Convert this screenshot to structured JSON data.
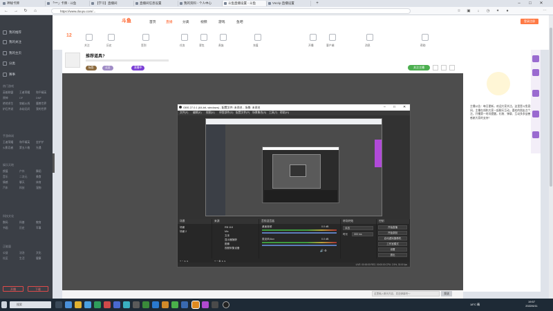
{
  "browser": {
    "tabs": [
      {
        "label": "神秘卡牌"
      },
      {
        "label": "「***」卡牌 - 斗鱼"
      },
      {
        "label": "【学习】直播间"
      },
      {
        "label": "直播间信息设置"
      },
      {
        "label": "我的资料 - 个人中心"
      },
      {
        "label": "斗鱼直播设置 - 斗鱼"
      },
      {
        "label": "Vscrip 直播设置"
      }
    ],
    "url": "https://www.douyu.com/..."
  },
  "sidebar": {
    "main_items": [
      {
        "label": "我的推荐"
      },
      {
        "label": "我的关注"
      },
      {
        "label": "我的主页"
      },
      {
        "label": "分类"
      },
      {
        "label": "赛事"
      }
    ],
    "sections": [
      {
        "title": "热门游戏",
        "items": [
          "英雄联盟",
          "王者荣耀",
          "和平精英",
          "原神",
          "CF",
          "DNF",
          "绝地求生",
          "穿越火线",
          "魔兽世界",
          "炉石传说",
          "永劫无间",
          "我的世界"
        ]
      },
      {
        "title": "手游休闲",
        "items": [
          "王者荣耀",
          "和平精英",
          "金铲铲",
          "火影忍者",
          "第五人格",
          "光遇"
        ]
      },
      {
        "title": "娱乐天地",
        "items": [
          "颜值",
          "户外",
          "舞蹈",
          "音乐",
          "二次元",
          "美食",
          "情感",
          "聊天",
          "体育",
          "汽车",
          "科技",
          "宠物"
        ]
      },
      {
        "title": "科技文化",
        "items": [
          "数码",
          "科普",
          "教育",
          "书画",
          "历史",
          "军事"
        ]
      },
      {
        "title": "正能量",
        "items": [
          "公益",
          "法治",
          "文化",
          "社区",
          "生活",
          "健康"
        ]
      }
    ],
    "bottom_buttons": [
      "开播",
      "下载"
    ]
  },
  "header": {
    "logo": "斗鱼",
    "nav": [
      "首页",
      "直播",
      "分类",
      "视频",
      "游戏",
      "鱼吧"
    ],
    "date_number": "12",
    "categories": [
      "关注",
      "历史",
      "签到",
      "任务",
      "背包",
      "贵族",
      "充值",
      "开播",
      "客户端",
      "消息",
      "帮助"
    ],
    "login_label": "登录注册"
  },
  "stream": {
    "title": "推荐道具?",
    "tags": [
      "标签",
      "认证",
      "直播中"
    ],
    "follow_label": "关注主播"
  },
  "obs": {
    "title": "OBS 27.0.1 (64-bit, windows) - 配置文件: 未命名 - 场景: 未命名",
    "menu": [
      "文件(F)",
      "编辑(E)",
      "视图(V)",
      "停靠部件(D)",
      "配置文件(P)",
      "场景集合(S)",
      "工具(T)",
      "帮助(H)"
    ],
    "dock_heads": [
      "场景",
      "来源",
      "音频混音器",
      "转场特效",
      "控制"
    ],
    "scenes": [
      "场景",
      "场景 2"
    ],
    "sources": [
      "RB 118",
      "Mic",
      "文本",
      "显示器捕获",
      "图像",
      "视频采集设备"
    ],
    "mixer": [
      {
        "name": "桌面音频",
        "level": "0.0 dB"
      },
      {
        "name": "麦克风/Aux",
        "level": "0.0 dB"
      }
    ],
    "transitions": {
      "type": "淡出",
      "duration_label": "时长",
      "duration": "300 ms"
    },
    "controls": [
      "开始直播",
      "开始录制",
      "启动虚拟摄像机",
      "工作室模式",
      "设置",
      "退出"
    ],
    "status": "LIVE: 00:00:00   REC: 00:00:00   CPU: 2.5%, 30.00 fps"
  },
  "right_panel": {
    "notice": "主播公告：每日更新，欢迎大家关注。这里是斗鱼直播间，主播在线和大家一起聊天互动，喜欢的朋友点个关注，开播第一时间提醒。礼物、弹幕、互动多多益善，感谢大家的支持！"
  },
  "chat": {
    "placeholder": "这里输入聊天内容，发送弹幕吧～",
    "send_label": "发送"
  },
  "taskbar": {
    "search_placeholder": "搜索",
    "tray": "18°C 晴",
    "time": "19:57",
    "date": "2022/6/11"
  },
  "colors": {
    "brand": "#ff5d23",
    "sidebar_bg": "#3b3f46",
    "obs_bg": "#2b2b2b",
    "gift_purple": "#9a6ad0"
  }
}
